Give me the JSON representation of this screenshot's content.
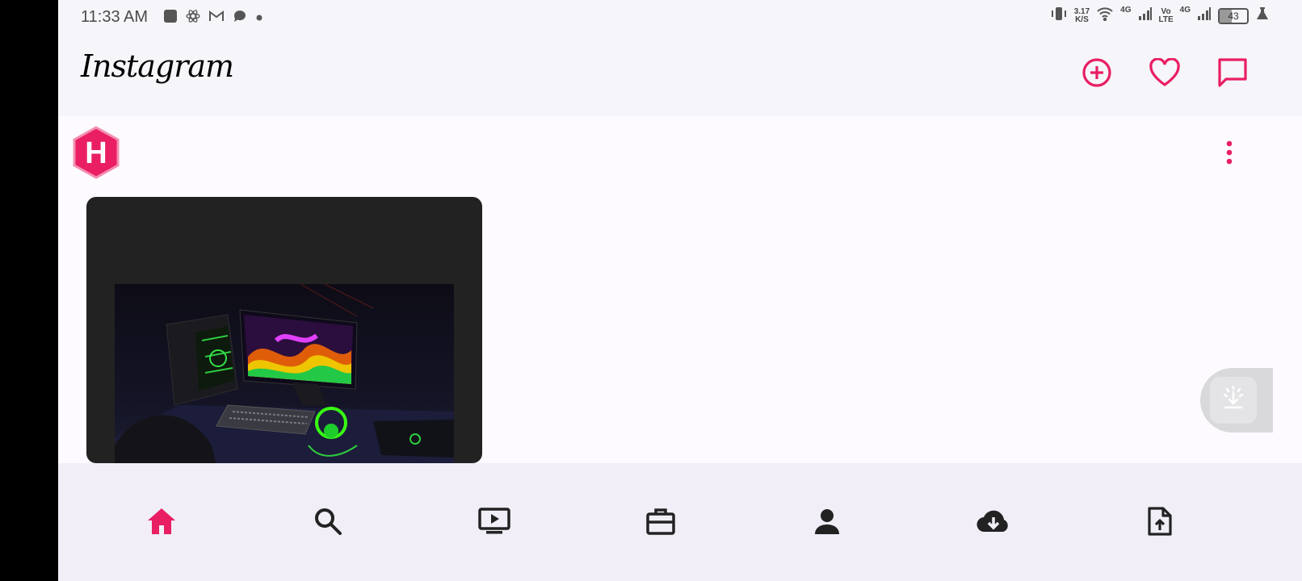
{
  "status_bar": {
    "time": "11:33 AM",
    "speed_value": "3.17",
    "speed_unit": "K/S",
    "network_1": "4G",
    "volte_top": "Vo",
    "volte_bottom": "LTE",
    "network_2": "4G",
    "battery_level": "43",
    "icons": [
      "square-app-icon",
      "atom-icon",
      "gmail-icon",
      "chat-bubble-icon",
      "dot-icon",
      "vibrate-icon",
      "wifi-icon",
      "signal-icon",
      "battery-icon",
      "lab-flask-icon"
    ]
  },
  "app_bar": {
    "logo_text": "Instagram",
    "actions": [
      "add-post-icon",
      "heart-icon",
      "messages-icon"
    ]
  },
  "post": {
    "avatar_letter": "H",
    "menu_icon": "more-vert-icon"
  },
  "bottom_nav": {
    "items": [
      "home-icon",
      "search-icon",
      "video-icon",
      "briefcase-icon",
      "person-icon",
      "cloud-download-icon",
      "file-upload-icon"
    ],
    "active_index": 0
  },
  "colors": {
    "accent": "#e91e63",
    "appbar_bg": "#f6f5fa",
    "nav_bg": "#f1eef8",
    "card_bg": "#222222",
    "icon_dark": "#222222"
  }
}
